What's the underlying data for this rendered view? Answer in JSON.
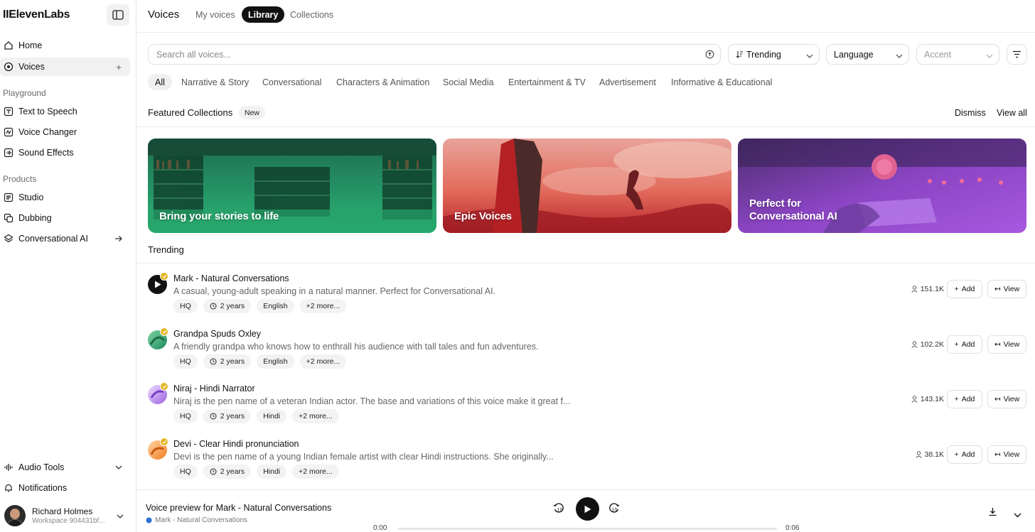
{
  "app": {
    "name": "IIElevenLabs"
  },
  "sidebar": {
    "nav_top": [
      {
        "label": "Home",
        "icon": "home-icon"
      },
      {
        "label": "Voices",
        "icon": "voices-icon"
      }
    ],
    "playground_label": "Playground",
    "playground": [
      {
        "label": "Text to Speech",
        "icon": "text-to-speech-icon"
      },
      {
        "label": "Voice Changer",
        "icon": "voice-changer-icon"
      },
      {
        "label": "Sound Effects",
        "icon": "sound-effects-icon"
      }
    ],
    "products_label": "Products",
    "products": [
      {
        "label": "Studio",
        "icon": "studio-icon"
      },
      {
        "label": "Dubbing",
        "icon": "dubbing-icon"
      },
      {
        "label": "Conversational AI",
        "icon": "conversational-ai-icon"
      }
    ],
    "bottom": [
      {
        "label": "Audio Tools",
        "icon": "audio-tools-icon"
      },
      {
        "label": "Notifications",
        "icon": "bell-icon"
      }
    ],
    "user": {
      "name": "Richard Holmes",
      "workspace": "Workspace 904431bf..."
    }
  },
  "header": {
    "title": "Voices",
    "tabs": [
      {
        "label": "My voices",
        "active": false
      },
      {
        "label": "Library",
        "active": true
      },
      {
        "label": "Collections",
        "active": false
      }
    ]
  },
  "filters": {
    "search_placeholder": "Search all voices...",
    "sort": "Trending",
    "language": "Language",
    "accent": "Accent"
  },
  "categories": [
    "All",
    "Narrative & Story",
    "Conversational",
    "Characters & Animation",
    "Social Media",
    "Entertainment & TV",
    "Advertisement",
    "Informative & Educational"
  ],
  "featured": {
    "title": "Featured Collections",
    "badge": "New",
    "dismiss": "Dismiss",
    "view_all": "View all",
    "cards": [
      {
        "label": "Bring your stories to life"
      },
      {
        "label": "Epic Voices"
      },
      {
        "label": "Perfect for Conversational AI"
      }
    ]
  },
  "trending": {
    "title": "Trending",
    "voices": [
      {
        "name": "Mark - Natural Conversations",
        "description": "A casual, young-adult speaking in a natural manner. Perfect for Conversational AI.",
        "tags": [
          "HQ",
          "2 years",
          "English",
          "+2 more..."
        ],
        "count": "151.1K"
      },
      {
        "name": "Grandpa Spuds Oxley",
        "description": "A friendly grandpa who knows how to enthrall his audience with tall tales and fun adventures.",
        "tags": [
          "HQ",
          "2 years",
          "English",
          "+2 more..."
        ],
        "count": "102.2K"
      },
      {
        "name": "Niraj - Hindi Narrator",
        "description": "Niraj is the pen name of a veteran Indian actor. The base and variations of this voice make it great f...",
        "tags": [
          "HQ",
          "2 years",
          "Hindi",
          "+2 more..."
        ],
        "count": "143.1K"
      },
      {
        "name": "Devi - Clear Hindi pronunciation",
        "description": "Devi is the pen name of a young Indian female artist with clear Hindi instructions. She originally...",
        "tags": [
          "HQ",
          "2 years",
          "Hindi",
          "+2 more..."
        ],
        "count": "38.1K"
      }
    ],
    "add_label": "Add",
    "view_label": "View"
  },
  "player": {
    "title": "Voice preview for Mark - Natural Conversations",
    "subtitle": "Mark - Natural Conversations",
    "time_current": "0:00",
    "time_total": "0:06",
    "progress": 0
  }
}
